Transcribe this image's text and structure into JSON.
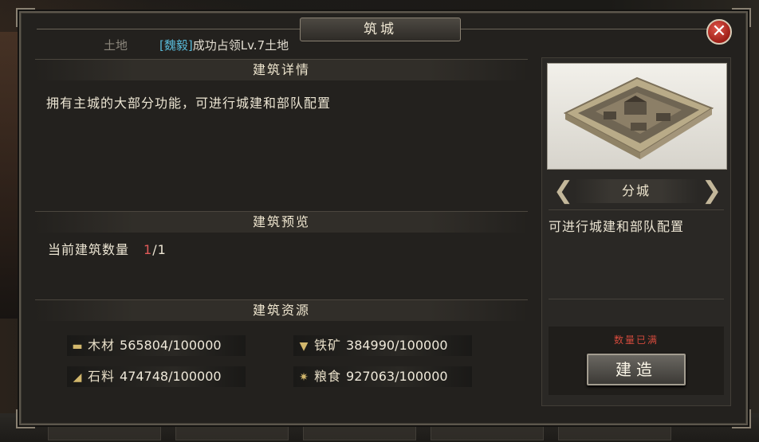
{
  "dialog": {
    "title": "筑城",
    "close_label": "✕"
  },
  "notice": {
    "prefix": "土地",
    "player": "[魏毅]",
    "message": "成功占领Lv.7土地"
  },
  "details": {
    "heading": "建筑详情",
    "description": "拥有主城的大部分功能，可进行城建和部队配置"
  },
  "preview": {
    "heading": "建筑预览",
    "count_label": "当前建筑数量",
    "count_current": "1",
    "count_total": "/1"
  },
  "resources": {
    "heading": "建筑资源",
    "items": [
      {
        "icon": "wood-icon",
        "name": "木材",
        "value": "565804/100000"
      },
      {
        "icon": "iron-icon",
        "name": "铁矿",
        "value": "384990/100000"
      },
      {
        "icon": "stone-icon",
        "name": "石料",
        "value": "474748/100000"
      },
      {
        "icon": "grain-icon",
        "name": "粮食",
        "value": "927063/100000"
      }
    ]
  },
  "city": {
    "name": "分城",
    "description": "可进行城建和部队配置",
    "status": "数量已满",
    "build_label": "建造",
    "prev_arrow": "❮",
    "next_arrow": "❯"
  },
  "colors": {
    "player_name": "#58b9d8",
    "warning": "#d24a3c",
    "count_current": "#e05a58"
  }
}
